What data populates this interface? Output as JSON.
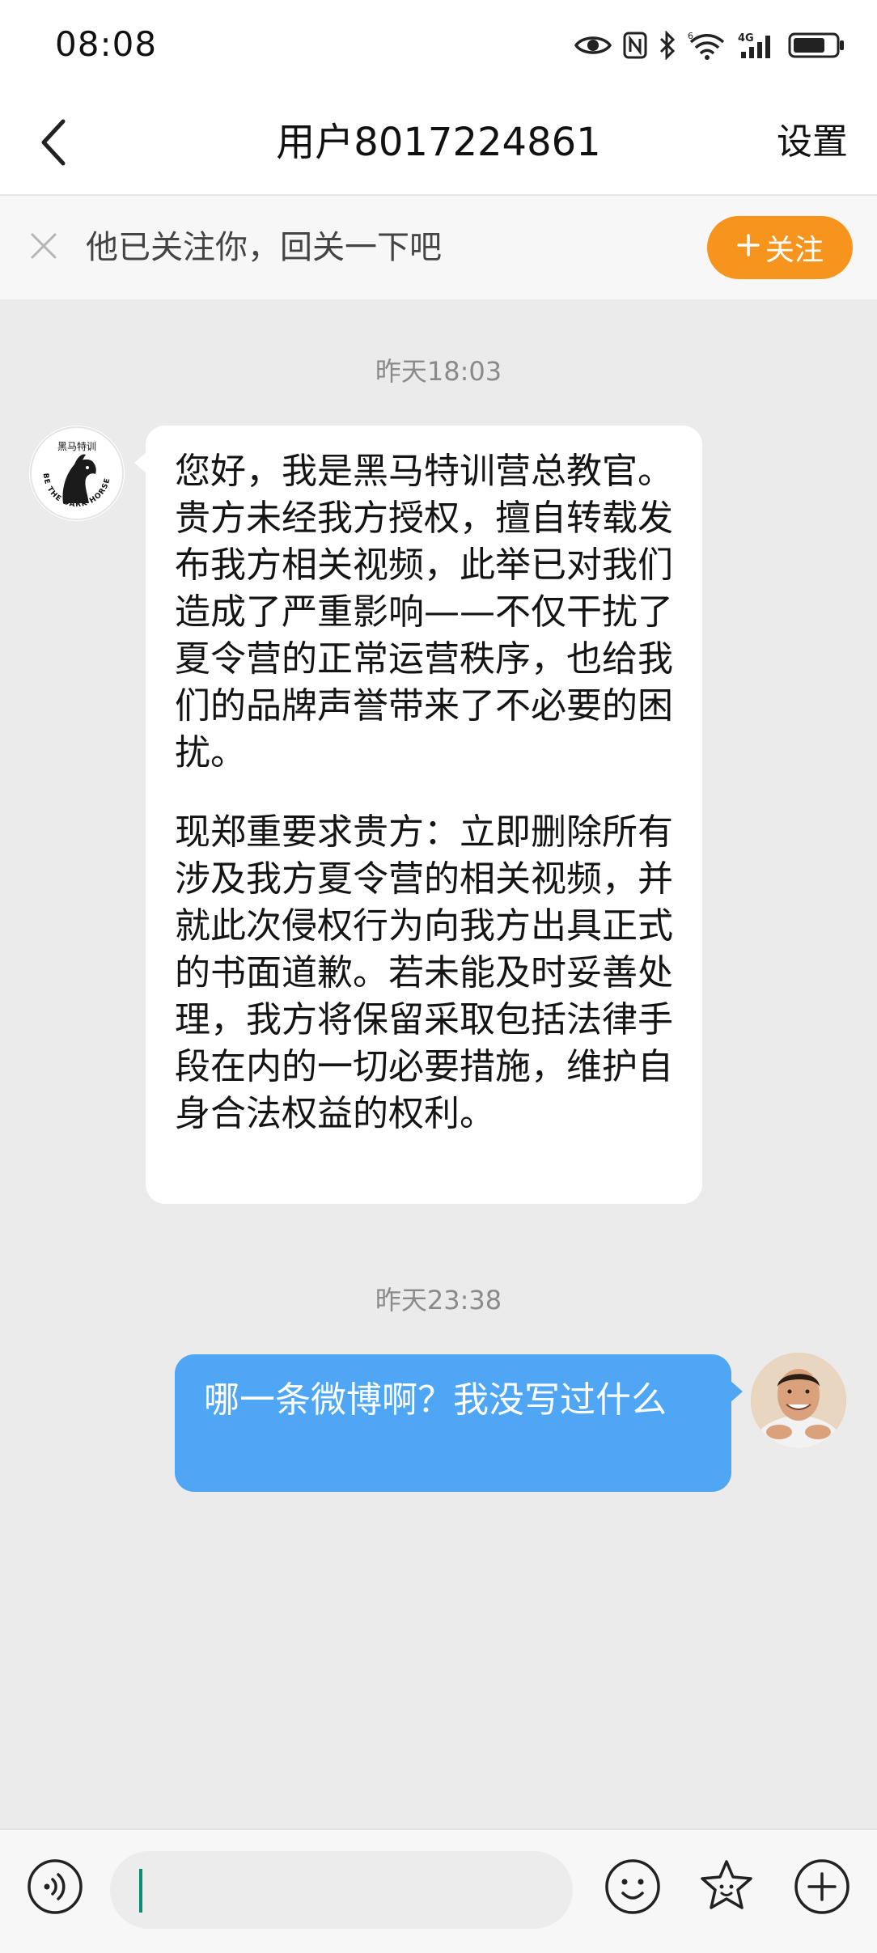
{
  "status_bar": {
    "time": "08:08",
    "icons": [
      "eye-icon",
      "nfc-icon",
      "bluetooth-icon",
      "wifi-icon",
      "signal-4g-icon",
      "battery-icon"
    ],
    "wifi_label": "6",
    "network_label": "4G"
  },
  "header": {
    "back_icon": "chevron-left-icon",
    "title": "用户8017224861",
    "settings_label": "设置"
  },
  "follow_banner": {
    "close_icon": "close-icon",
    "text": "他已关注你，回关一下吧",
    "follow_button": "关注",
    "follow_icon": "plus-icon",
    "button_color": "#f7941d"
  },
  "chat": {
    "timestamps": [
      "昨天18:03",
      "昨天23:38"
    ],
    "messages": [
      {
        "sender": "other",
        "avatar_text": "黑马特训",
        "avatar_ring_text": "BE THE DARK HORSE",
        "paragraphs": [
          "您好，我是黑马特训营总教官。贵方未经我方授权，擅自转载发布我方相关视频，此举已对我们造成了严重影响——不仅干扰了夏令营的正常运营秩序，也给我们的品牌声誉带来了不必要的困扰。",
          "现郑重要求贵方：立即删除所有涉及我方夏令营的相关视频，并就此次侵权行为向我方出具正式的书面道歉。若未能及时妥善处理，我方将保留采取包括法律手段在内的一切必要措施，维护自身合法权益的权利。"
        ]
      },
      {
        "sender": "self",
        "avatar": "user-photo",
        "paragraphs": [
          "哪一条微博啊？我没写过什么"
        ],
        "bubble_color": "#4ea6f4"
      }
    ]
  },
  "input_bar": {
    "voice_icon": "voice-icon",
    "input_value": "",
    "emoji_icon": "emoji-icon",
    "sticker_icon": "sticker-icon",
    "plus_icon": "plus-circle-icon"
  }
}
